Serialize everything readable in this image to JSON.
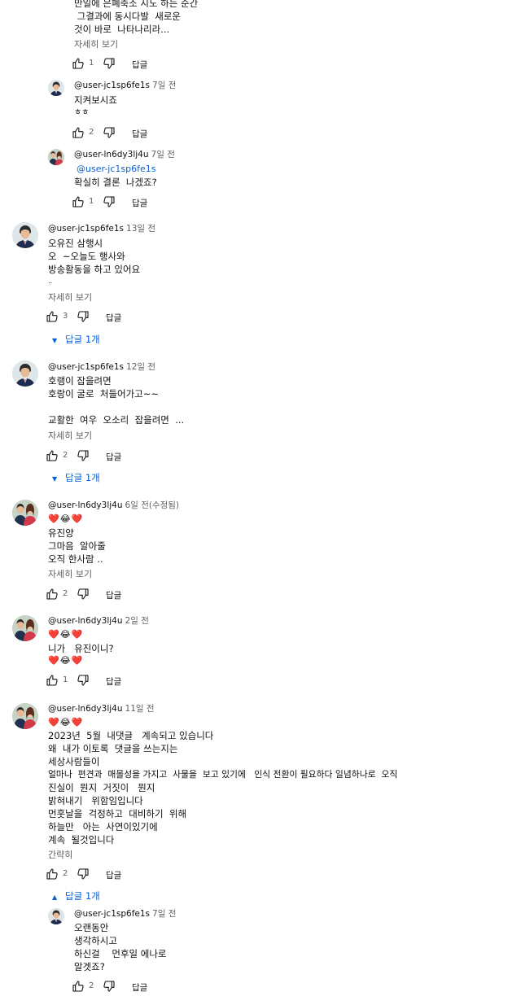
{
  "top_partial": {
    "lines": [
      "만일에 은폐축소 시도 하는 순간",
      " 그결과에 동시다발  새로운",
      "것이 바로  나타나리라..."
    ],
    "more": "자세히 보기",
    "likes": "1",
    "reply": "답글"
  },
  "reply_a": {
    "author": "@user-jc1sp6fe1s",
    "time": "7일 전",
    "lines": [
      "지켜보시죠",
      "ㅎㅎ"
    ],
    "likes": "2",
    "reply": "답글"
  },
  "reply_b": {
    "author": "@user-ln6dy3lj4u",
    "time": "7일 전",
    "mention": "@user-jc1sp6fe1s",
    "lines": [
      "확실히 결론  나겠죠?"
    ],
    "likes": "1",
    "reply": "답글"
  },
  "comment_1": {
    "author": "@user-jc1sp6fe1s",
    "time": "13일 전",
    "lines": [
      "오유진 삼행시",
      "오  ~오늘도 행사와",
      "방송활동을 하고 있어요",
      ".."
    ],
    "more": "자세히 보기",
    "likes": "3",
    "reply": "답글",
    "replies": "답글 1개"
  },
  "comment_2": {
    "author": "@user-jc1sp6fe1s",
    "time": "12일 전",
    "lines": [
      "호랭이 잡을려면",
      "호랑이 굴로  처들어가고~~",
      "",
      "교활한  여우  오소리  잡을려면  ..."
    ],
    "more": "자세히 보기",
    "likes": "2",
    "reply": "답글",
    "replies": "답글 1개"
  },
  "comment_3": {
    "author": "@user-ln6dy3lj4u",
    "time": "6일 전(수정됨)",
    "emoji": "❤️😂❤️",
    "lines": [
      "유진양",
      "그마음  알아줄",
      "오직 한사람 .."
    ],
    "more": "자세히 보기",
    "likes": "2",
    "reply": "답글"
  },
  "comment_4": {
    "author": "@user-ln6dy3lj4u",
    "time": "2일 전",
    "emoji": "❤️😂❤️",
    "lines": [
      "니가   유진이니?"
    ],
    "emoji2": "❤️😂❤️",
    "likes": "1",
    "reply": "답글"
  },
  "comment_5": {
    "author": "@user-ln6dy3lj4u",
    "time": "11일 전",
    "emoji": "❤️😂❤️",
    "lines": [
      "2023년  5월  내댓글   계속되고 있습니다",
      "왜  내가 이토록  댓글을 쓰는지는",
      "세상사람들이",
      "얼마나  편견과  매몰성을 가지고  사물을  보고 있기에   인식 전환이 필요하다 일념하나로  오직",
      "진실이  뭔지  거짓이   뭔지",
      "밝혀내기   위함임입니다",
      "먼훗날을  걱정하고  대비하기  위해",
      "하늘만   아는  사연이있기에",
      "계속  될것입니다"
    ],
    "less": "간략히",
    "likes": "2",
    "reply": "답글",
    "replies": "답글 1개"
  },
  "reply_c": {
    "author": "@user-jc1sp6fe1s",
    "time": "7일 전",
    "lines": [
      "오랜동안",
      "생각하시고",
      "하신걸    먼후일 에나로",
      "알겟죠?"
    ],
    "likes": "2",
    "reply": "답글"
  }
}
